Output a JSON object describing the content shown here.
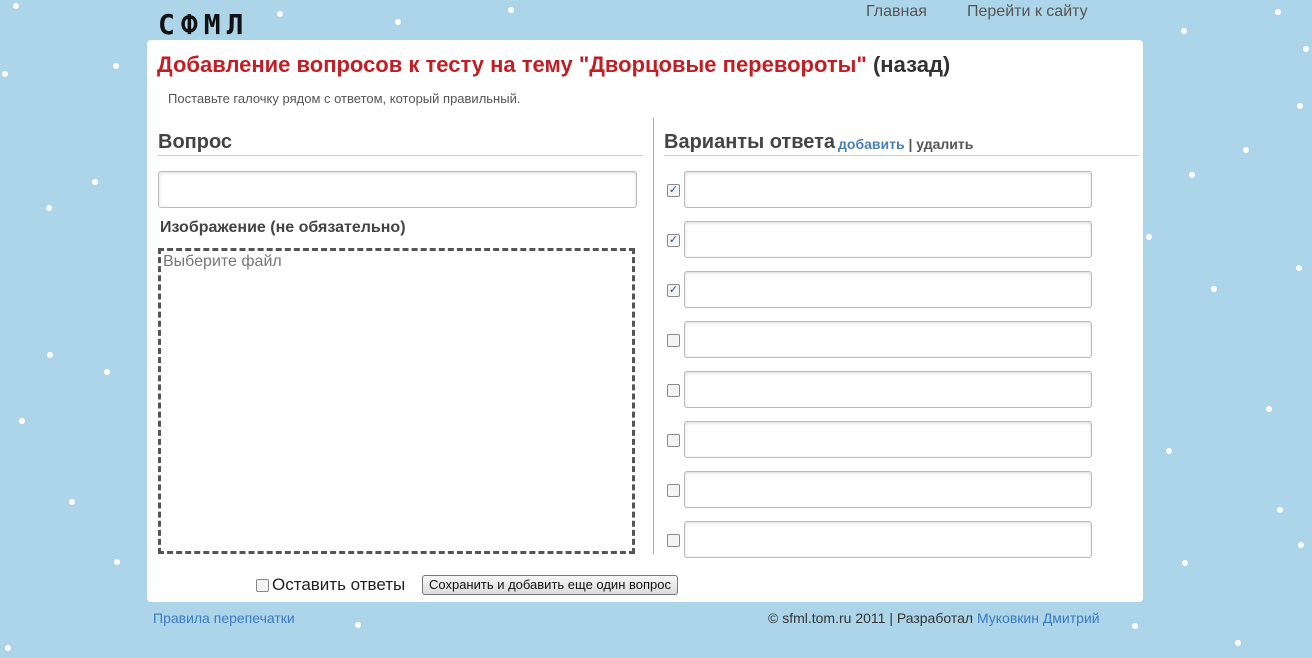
{
  "header": {
    "logo": "СФМЛ",
    "nav": [
      {
        "label": "Главная"
      },
      {
        "label": "Перейти к сайту"
      }
    ]
  },
  "page": {
    "title": "Добавление вопросов к тесту на тему \"Дворцовые перевороты\"",
    "back_link": "(назад)",
    "hint": "Поставьте галочку рядом с ответом, который правильный."
  },
  "question": {
    "section_title": "Вопрос",
    "value": "",
    "image_label": "Изображение (не обязательно)",
    "dropzone_text": "Выберите файл"
  },
  "answers": {
    "section_title": "Варианты ответа",
    "add_link": "добавить",
    "separator": "|",
    "delete_link": "удалить",
    "items": [
      {
        "checked": true,
        "value": ""
      },
      {
        "checked": true,
        "value": ""
      },
      {
        "checked": true,
        "value": ""
      },
      {
        "checked": false,
        "value": ""
      },
      {
        "checked": false,
        "value": ""
      },
      {
        "checked": false,
        "value": ""
      },
      {
        "checked": false,
        "value": ""
      },
      {
        "checked": false,
        "value": ""
      }
    ]
  },
  "form": {
    "keep_answers_label": "Оставить ответы",
    "keep_answers_checked": false,
    "save_button": "Сохранить и добавить еще один вопрос"
  },
  "footer": {
    "rules_link": "Правила перепечатки",
    "copyright": "© sfml.tom.ru 2011 | Разработал",
    "author": "Муковкин Дмитрий"
  },
  "colors": {
    "background": "#acd5ea",
    "title": "#c01f25",
    "link": "#3a7abf"
  }
}
